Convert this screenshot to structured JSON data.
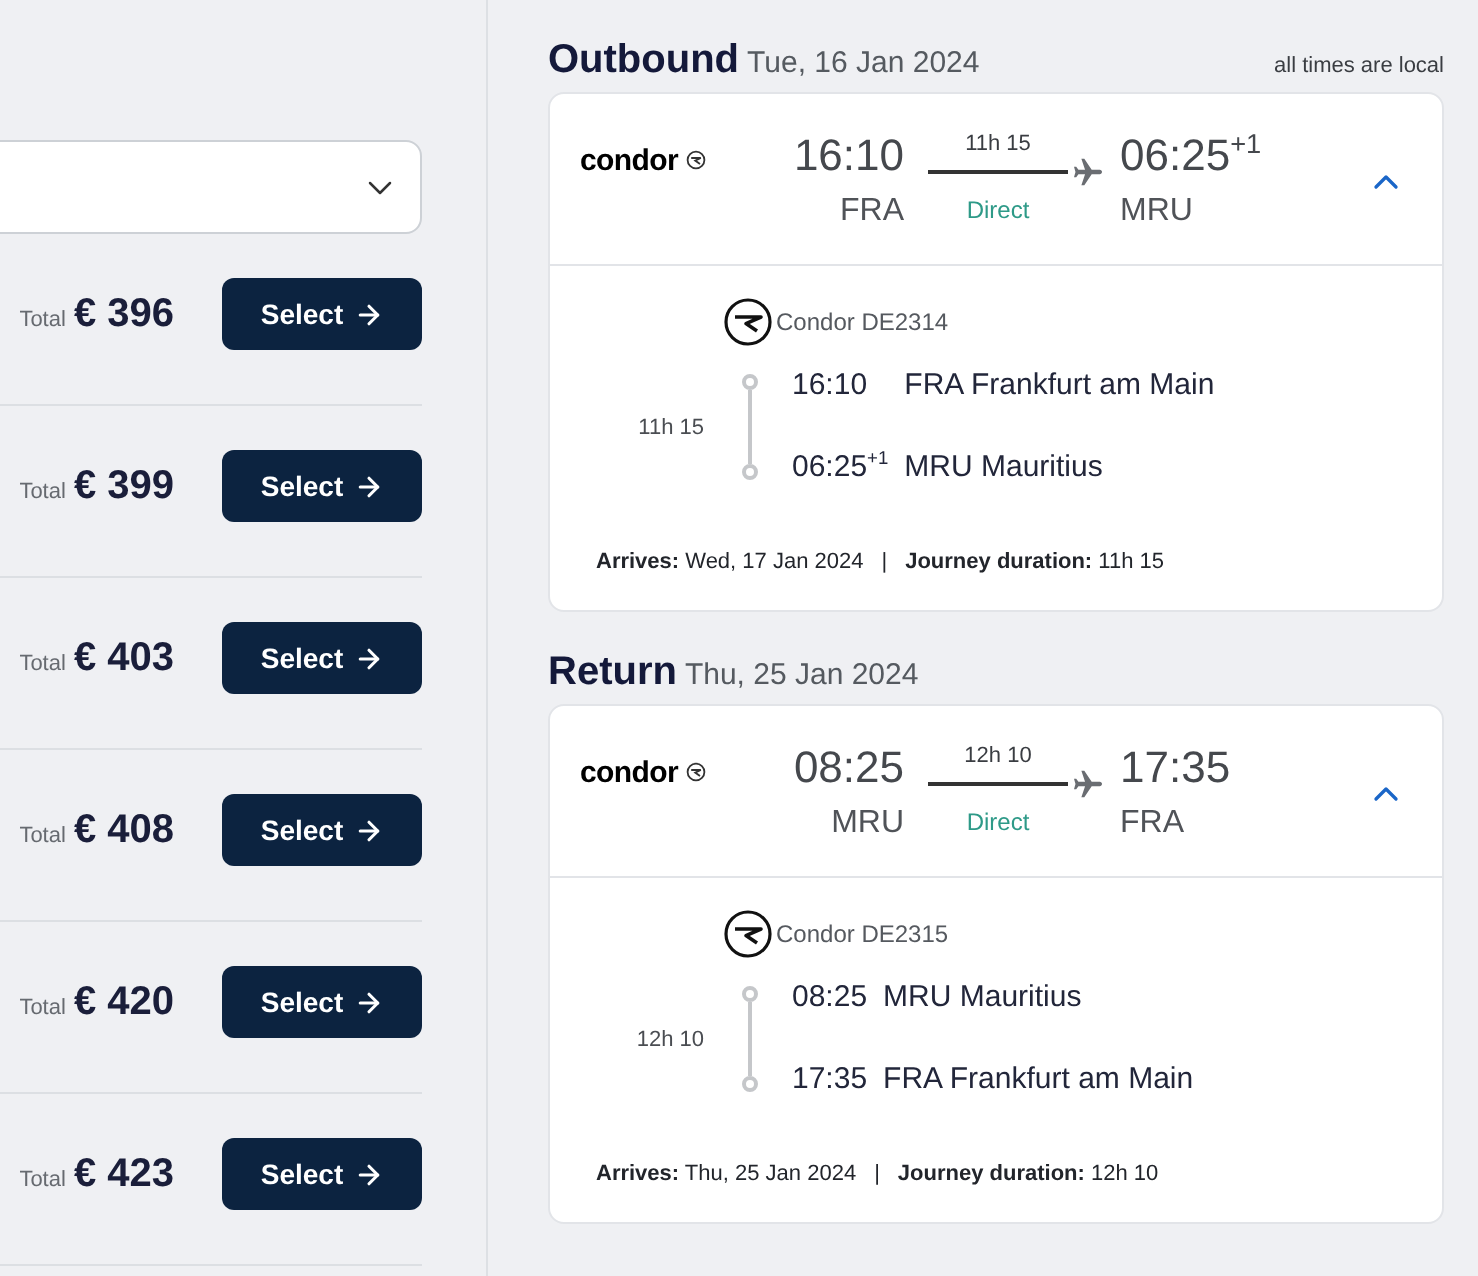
{
  "filter_dropdown": {
    "expanded": false
  },
  "offers": [
    {
      "label": "Total",
      "price": "€ 396",
      "action": "Select"
    },
    {
      "label": "Total",
      "price": "€ 399",
      "action": "Select"
    },
    {
      "label": "Total",
      "price": "€ 403",
      "action": "Select"
    },
    {
      "label": "Total",
      "price": "€ 408",
      "action": "Select"
    },
    {
      "label": "Total",
      "price": "€ 420",
      "action": "Select"
    },
    {
      "label": "Total",
      "price": "€ 423",
      "action": "Select"
    }
  ],
  "legs": [
    {
      "title": "Outbound",
      "date": "Tue, 16 Jan 2024",
      "note": "all times are local",
      "expanded": true,
      "airline_logo": "condor",
      "departure": {
        "time": "16:10",
        "airport": "FRA"
      },
      "duration": "11h 15",
      "connection": "Direct",
      "arrival": {
        "time": "06:25$^{+1}$",
        "airport": "MRU"
      },
      "details": {
        "flight": "Condor DE2314",
        "duration": "11h 15",
        "segments": [
          {
            "time": "16:10",
            "place": "FRA Frankfurt am Main"
          },
          {
            "time": "06:25$^{+1}$",
            "place": "MRU Mauritius"
          }
        ],
        "arrives": "**Arrives:** Wed, 17 Jan 2024",
        "separator": "|",
        "journey": "**Journey duration:** 11h 15"
      }
    },
    {
      "title": "Return",
      "date": "Thu, 25 Jan 2024",
      "expanded": true,
      "airline_logo": "condor",
      "departure": {
        "time": "08:25",
        "airport": "MRU"
      },
      "duration": "12h 10",
      "connection": "Direct",
      "arrival": {
        "time": "17:35",
        "airport": "FRA"
      },
      "details": {
        "flight": "Condor DE2315",
        "duration": "12h 10",
        "segments": [
          {
            "time": "08:25",
            "place": "MRU Mauritius"
          },
          {
            "time": "17:35",
            "place": "FRA Frankfurt am Main"
          }
        ],
        "arrives": "**Arrives:** Thu, 25 Jan 2024",
        "separator": "|",
        "journey": "**Journey duration:** 12h 10"
      }
    }
  ]
}
